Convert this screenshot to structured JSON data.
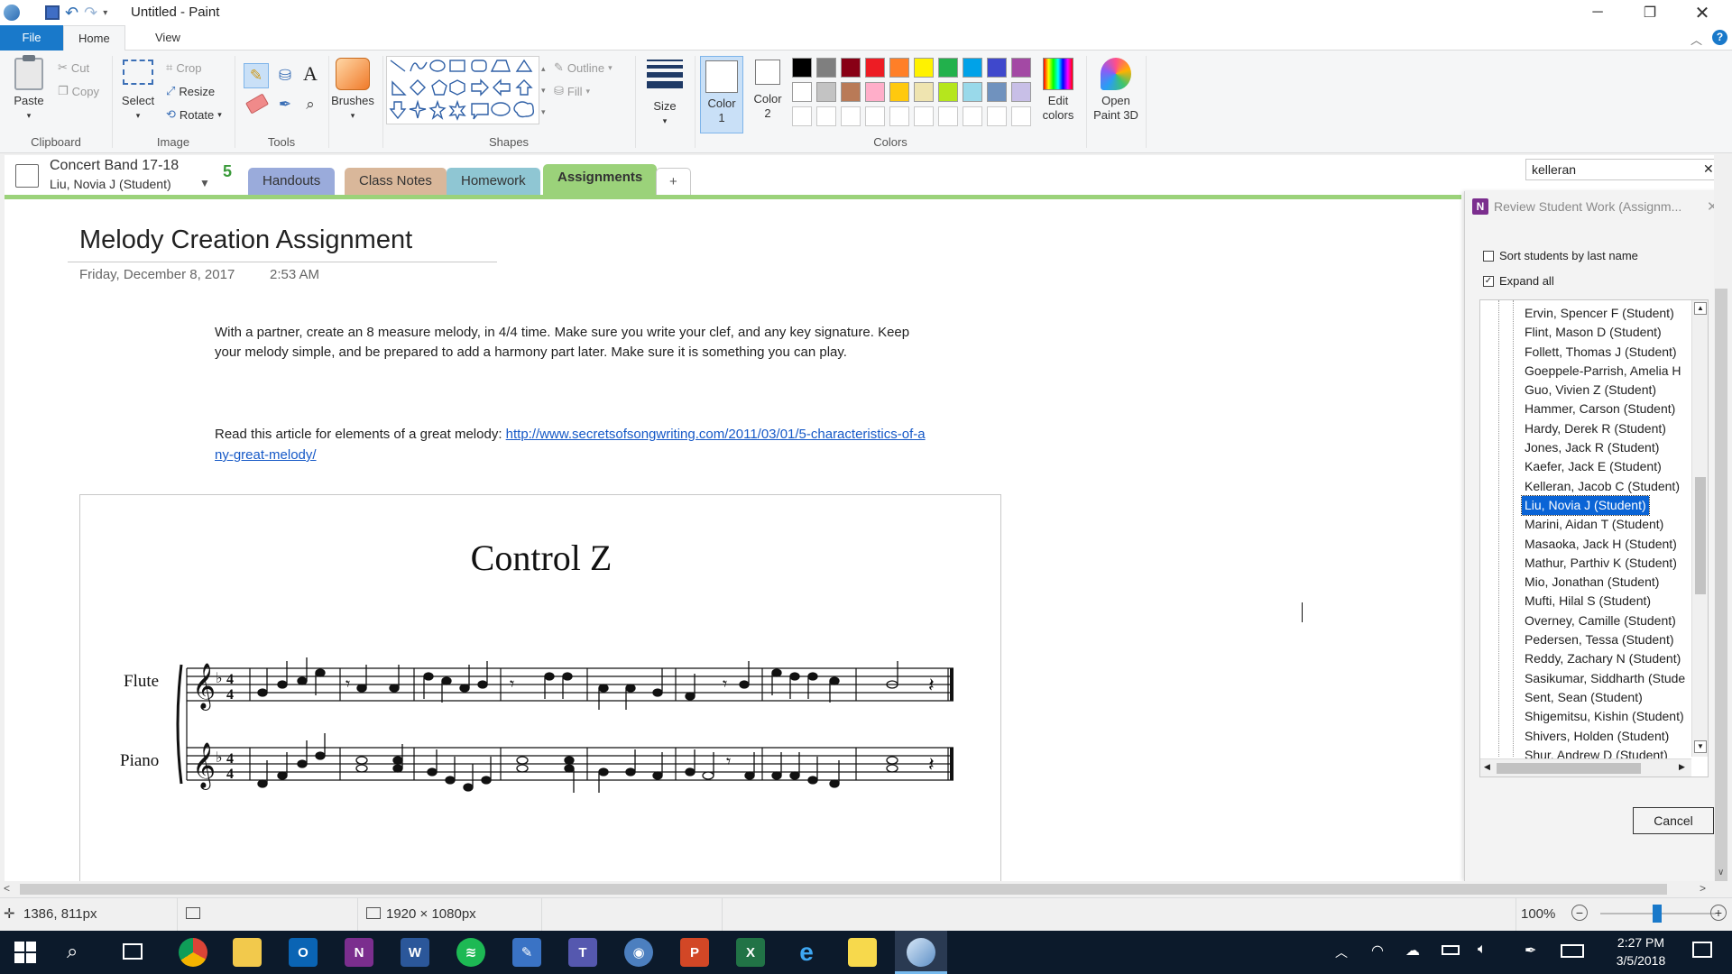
{
  "window": {
    "title": "Untitled - Paint"
  },
  "ribbon_tabs": {
    "file": "File",
    "home": "Home",
    "view": "View"
  },
  "ribbon": {
    "clipboard": {
      "paste": "Paste",
      "cut": "Cut",
      "copy": "Copy",
      "label": "Clipboard"
    },
    "image": {
      "select": "Select",
      "crop": "Crop",
      "resize": "Resize",
      "rotate": "Rotate",
      "label": "Image"
    },
    "tools": {
      "label": "Tools"
    },
    "brushes": {
      "label": "Brushes"
    },
    "shapes": {
      "outline": "Outline",
      "fill": "Fill",
      "label": "Shapes"
    },
    "size": {
      "label": "Size"
    },
    "colors": {
      "color1_line1": "Color",
      "color1_line2": "1",
      "color2_line1": "Color",
      "color2_line2": "2",
      "edit_line1": "Edit",
      "edit_line2": "colors",
      "label": "Colors",
      "palette_row1": [
        "#000000",
        "#7f7f7f",
        "#880015",
        "#ed1c24",
        "#ff7f27",
        "#fff200",
        "#22b14c",
        "#00a2e8",
        "#3f48cc",
        "#a349a4"
      ],
      "palette_row2": [
        "#ffffff",
        "#c3c3c3",
        "#b97a57",
        "#ffaec9",
        "#ffc90e",
        "#efe4b0",
        "#b5e61d",
        "#99d9ea",
        "#7092be",
        "#c8bfe7"
      ]
    },
    "paint3d": {
      "line1": "Open",
      "line2": "Paint 3D"
    }
  },
  "onenote": {
    "notebook": "Concert Band 17-18",
    "student": "Liu, Novia J (Student)",
    "sync_badge": "5",
    "tabs": [
      "Handouts",
      "Class Notes",
      "Homework",
      "Assignments",
      "+"
    ],
    "search_value": "kelleran",
    "page": {
      "title": "Melody Creation Assignment",
      "date": "Friday, December 8, 2017",
      "time": "2:53 AM",
      "paragraph1": "With a partner, create an 8 measure melody, in 4/4 time. Make sure you write your clef, and any key signature. Keep your melody simple, and be prepared to add a harmony part later. Make sure it is something you can play.",
      "paragraph2_prefix": "Read this article for elements of a great melody: ",
      "link": "http://www.secretsofsongwriting.com/2011/03/01/5-characteristics-of-any-great-melody/",
      "score_title": "Control Z",
      "instrument1": "Flute",
      "instrument2": "Piano"
    },
    "review_panel": {
      "title": "Review Student Work (Assignm...",
      "sort_label": "Sort students by last name",
      "expand_label": "Expand all",
      "students": [
        "Ervin, Spencer F (Student)",
        "Flint, Mason D (Student)",
        "Follett, Thomas J (Student)",
        "Goeppele-Parrish, Amelia H",
        "Guo, Vivien Z (Student)",
        "Hammer, Carson (Student)",
        "Hardy, Derek R (Student)",
        "Jones, Jack R (Student)",
        "Kaefer, Jack E (Student)",
        "Kelleran, Jacob C (Student)",
        "Liu, Novia J (Student)",
        "Marini, Aidan T (Student)",
        "Masaoka, Jack H (Student)",
        "Mathur, Parthiv K (Student)",
        "Mio, Jonathan (Student)",
        "Mufti, Hilal S (Student)",
        "Overney, Camille (Student)",
        "Pedersen, Tessa  (Student)",
        "Reddy, Zachary N (Student)",
        "Sasikumar, Siddharth (Stude",
        "Sent, Sean (Student)",
        "Shigemitsu, Kishin (Student)",
        "Shivers, Holden (Student)",
        "Shur, Andrew D (Student)"
      ],
      "selected_student": "Liu, Novia J (Student)",
      "cancel": "Cancel"
    }
  },
  "statusbar": {
    "cursor_pos": "1386, 811px",
    "image_size": "1920 × 1080px",
    "zoom": "100%"
  },
  "taskbar": {
    "time": "2:27 PM",
    "date": "3/5/2018"
  }
}
